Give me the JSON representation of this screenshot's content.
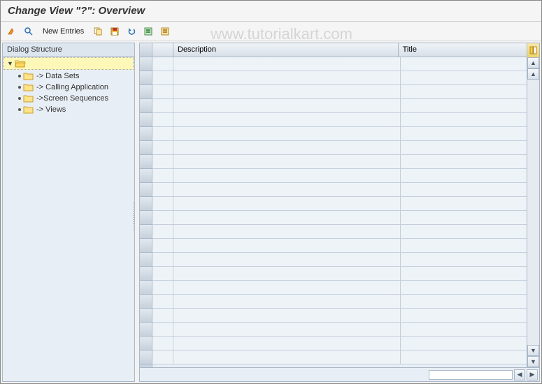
{
  "title": "Change View \"?\": Overview",
  "watermark": "www.tutorialkart.com",
  "toolbar": {
    "new_entries_label": "New Entries"
  },
  "sidebar": {
    "header": "Dialog Structure",
    "items": [
      {
        "label": "-> Data Sets"
      },
      {
        "label": "-> Calling Application"
      },
      {
        "label": "->Screen Sequences"
      },
      {
        "label": "-> Views"
      }
    ]
  },
  "grid": {
    "columns": {
      "description": "Description",
      "title": "Title"
    },
    "row_count": 22
  }
}
